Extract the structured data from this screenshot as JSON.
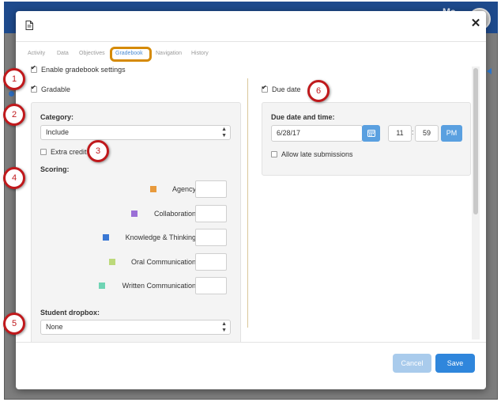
{
  "topbar": {
    "user_initials": "Ma"
  },
  "tabs": [
    {
      "label": "Activity"
    },
    {
      "label": "Data"
    },
    {
      "label": "Objectives"
    },
    {
      "label": "Gradebook",
      "active": true
    },
    {
      "label": "Navigation"
    },
    {
      "label": "History"
    }
  ],
  "settings": {
    "enable_gradebook_label": "Enable gradebook settings",
    "enable_gradebook_checked": true,
    "gradable_label": "Gradable",
    "gradable_checked": true
  },
  "left_panel": {
    "category_label": "Category:",
    "category_value": "Include",
    "extra_credit_label": "Extra credit",
    "extra_credit_checked": false,
    "scoring_label": "Scoring:",
    "scoring_items": [
      {
        "label": "Agency",
        "color": "#e89a3c"
      },
      {
        "label": "Collaboration",
        "color": "#9a6fd6"
      },
      {
        "label": "Knowledge & Thinking",
        "color": "#3a78d4"
      },
      {
        "label": "Oral Communication",
        "color": "#bcd97a"
      },
      {
        "label": "Written Communication",
        "color": "#6fd4b4"
      }
    ],
    "dropbox_label": "Student dropbox:",
    "dropbox_value": "None"
  },
  "right_panel": {
    "due_date_label": "Due date",
    "due_date_checked": true,
    "due_datetime_label": "Due date and time:",
    "date_value": "6/28/17",
    "hour_value": "11",
    "minute_value": "59",
    "ampm_value": "PM",
    "allow_late_label": "Allow late submissions",
    "allow_late_checked": false
  },
  "footer": {
    "cancel_label": "Cancel",
    "save_label": "Save"
  },
  "callouts": [
    "1",
    "2",
    "3",
    "4",
    "5",
    "6"
  ],
  "colors": {
    "accent": "#2f86dc",
    "highlight": "#d58a06",
    "callout": "#c0191c"
  }
}
